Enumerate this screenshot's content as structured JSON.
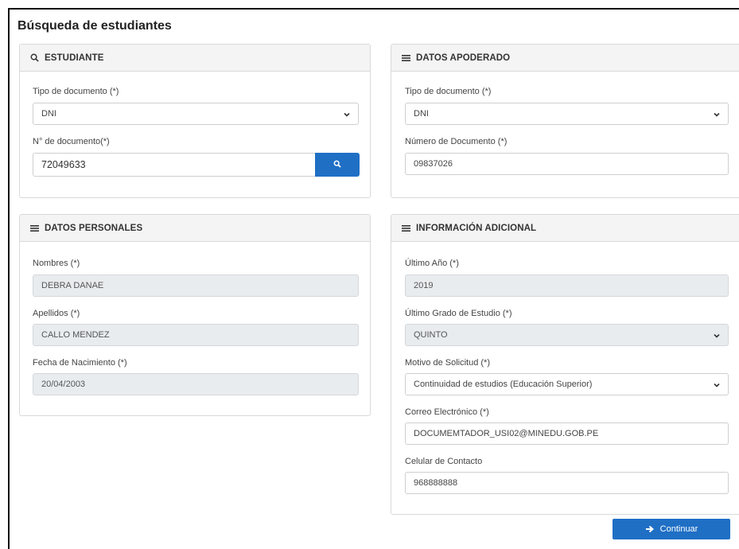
{
  "page": {
    "title": "Búsqueda de estudiantes"
  },
  "estudiante": {
    "header": "ESTUDIANTE",
    "tipo_doc_label": "Tipo de documento (*)",
    "tipo_doc_value": "DNI",
    "num_doc_label": "N° de documento(*)",
    "num_doc_value": "72049633"
  },
  "apoderado": {
    "header": "DATOS APODERADO",
    "tipo_doc_label": "Tipo de documento (*)",
    "tipo_doc_value": "DNI",
    "num_doc_label": "Número de Documento (*)",
    "num_doc_value": "09837026"
  },
  "personales": {
    "header": "DATOS PERSONALES",
    "nombres_label": "Nombres (*)",
    "nombres_value": "DEBRA DANAE",
    "apellidos_label": "Apellidos (*)",
    "apellidos_value": "CALLO MENDEZ",
    "fecha_label": "Fecha de Nacimiento (*)",
    "fecha_value": "20/04/2003"
  },
  "adicional": {
    "header": "INFORMACIÓN ADICIONAL",
    "ultimo_anio_label": "Último Año (*)",
    "ultimo_anio_value": "2019",
    "grado_label": "Último Grado de Estudio (*)",
    "grado_value": "QUINTO",
    "motivo_label": "Motivo de Solicitud (*)",
    "motivo_value": "Continuidad de estudios (Educación Superior)",
    "correo_label": "Correo Electrónico (*)",
    "correo_value": "DOCUMEMTADOR_USI02@MINEDU.GOB.PE",
    "celular_label": "Celular de Contacto",
    "celular_value": "968888888"
  },
  "actions": {
    "continue_label": "Continuar"
  },
  "colors": {
    "primary": "#1f6fc5",
    "readonly_bg": "#e9ecef",
    "header_bg": "#f4f4f4"
  }
}
